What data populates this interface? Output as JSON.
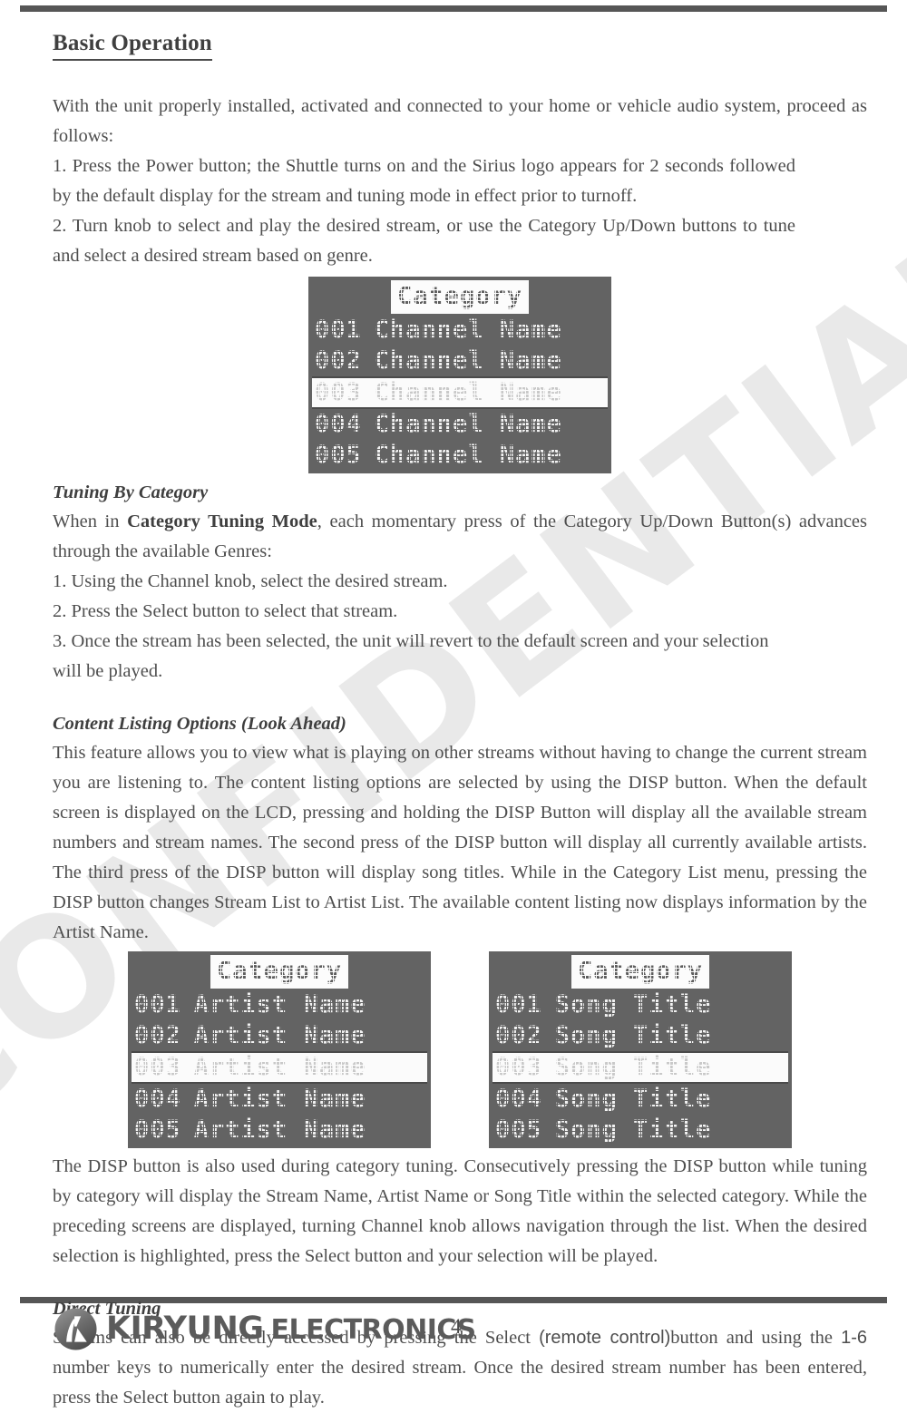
{
  "document": {
    "title": "Basic Operation",
    "watermark": "CONFIDENTIAL",
    "page_number": "4"
  },
  "intro": {
    "paragraph": "With the unit properly installed, activated and connected to your home or vehicle audio system, proceed as follows:",
    "steps": [
      "1. Press the Power button; the Shuttle turns on and the Sirius logo appears for 2 seconds followed by the default display for the stream and tuning mode in effect prior to turnoff.",
      "2. Turn knob to select and play the desired stream, or use the Category Up/Down buttons to tune and select a desired stream based on genre."
    ]
  },
  "lcd_channel": {
    "header": "Category",
    "rows": [
      {
        "number": "001",
        "label": "Channel Name",
        "selected": false
      },
      {
        "number": "002",
        "label": "Channel Name",
        "selected": false
      },
      {
        "number": "003",
        "label": "Channel Name",
        "selected": true
      },
      {
        "number": "004",
        "label": "Channel Name",
        "selected": false
      },
      {
        "number": "005",
        "label": "Channel Name",
        "selected": false
      }
    ]
  },
  "tuning_by_category": {
    "heading": "Tuning By Category",
    "intro_before_bold": "When in ",
    "intro_bold": "Category Tuning Mode",
    "intro_after_bold": ", each momentary press of the Category Up/Down Button(s) advances through the available Genres:",
    "steps": [
      "1. Using the Channel knob, select the desired stream.",
      "2. Press the Select button to select that stream.",
      "3. Once the stream has been selected, the unit will revert to the default screen and your selection will be played."
    ]
  },
  "content_listing": {
    "heading": "Content Listing Options (Look Ahead)",
    "paragraph": "This feature allows you to view what is playing on other streams without having to change the current stream you are listening to. The content listing options are selected by using the DISP button. When the default screen is displayed on the LCD, pressing and holding the DISP Button will display all the available stream numbers and stream names. The second press of the DISP button will display all currently available artists. The third press of the DISP button will display song titles. While in the Category List menu, pressing the DISP button changes Stream List to Artist List. The available content listing now displays information by the Artist Name."
  },
  "lcd_artist": {
    "header": "Category",
    "rows": [
      {
        "number": "001",
        "label": "Artist Name",
        "selected": false
      },
      {
        "number": "002",
        "label": "Artist Name",
        "selected": false
      },
      {
        "number": "003",
        "label": "Artist Name",
        "selected": true
      },
      {
        "number": "004",
        "label": "Artist Name",
        "selected": false
      },
      {
        "number": "005",
        "label": "Artist Name",
        "selected": false
      }
    ]
  },
  "lcd_song": {
    "header": "Category",
    "rows": [
      {
        "number": "001",
        "label": "Song Title",
        "selected": false
      },
      {
        "number": "002",
        "label": "Song Title",
        "selected": false
      },
      {
        "number": "003",
        "label": "Song Title",
        "selected": true
      },
      {
        "number": "004",
        "label": "Song Title",
        "selected": false
      },
      {
        "number": "005",
        "label": "Song Title",
        "selected": false
      }
    ]
  },
  "disp_paragraph": {
    "text": "The DISP button is also used during category tuning. Consecutively pressing the DISP button while tuning by category will display the Stream Name, Artist Name or Song Title within the selected category. While the preceding screens are displayed, turning Channel knob allows navigation through the list. When the desired selection is highlighted, press the Select button and your selection will be played."
  },
  "direct_tuning": {
    "heading": "Direct Tuning",
    "part_1": "Streams can also be directly accessed by pressing the Select ",
    "part_sans_1": "(remote control)",
    "part_2": "button and using the ",
    "part_sans_2": "1-6",
    "part_3": " number keys to numerically enter the desired stream. Once the desired stream number has been entered, press the Select button again to play."
  },
  "footer": {
    "brand_primary": "KIRYUNG",
    "brand_secondary": "ELECTRONICS",
    "logo_icon": "kiryung-circle-logo"
  },
  "colors": {
    "rule": "#565656",
    "body_text": "#4e4e4e",
    "lcd_background": "#636363",
    "lcd_pixel": "#f2f2f2",
    "watermark": "#e9e9e9",
    "brand": "#5b5b5b"
  }
}
